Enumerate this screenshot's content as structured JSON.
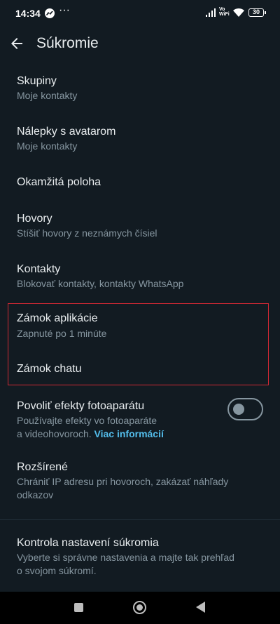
{
  "status_bar": {
    "time": "14:34",
    "vowifi_top": "Vo",
    "vowifi_bottom": "WiFi",
    "battery": "30"
  },
  "header": {
    "title": "Súkromie"
  },
  "items": [
    {
      "title": "Skupiny",
      "subtitle": "Moje kontakty"
    },
    {
      "title": "Nálepky s avatarom",
      "subtitle": "Moje kontakty"
    },
    {
      "title": "Okamžitá poloha"
    },
    {
      "title": "Hovory",
      "subtitle": "Stíšiť hovory z neznámych čísiel"
    },
    {
      "title": "Kontakty",
      "subtitle": "Blokovať kontakty, kontakty WhatsApp"
    },
    {
      "title": "Zámok aplikácie",
      "subtitle": "Zapnuté po 1 minúte"
    },
    {
      "title": "Zámok chatu"
    },
    {
      "title": "Povoliť efekty fotoaparátu",
      "subtitle_line1": "Používajte efekty vo fotoaparáte",
      "subtitle_line2": "a videohovoroch.",
      "link": "Viac informácií",
      "toggle_on": false
    },
    {
      "title": "Rozšírené",
      "subtitle_line1": "Chrániť IP adresu pri hovoroch, zakázať náhľady",
      "subtitle_line2": "odkazov"
    },
    {
      "title": "Kontrola nastavení súkromia",
      "subtitle_line1": "Vyberte si správne nastavenia a majte tak prehľad",
      "subtitle_line2": "o svojom súkromí."
    }
  ],
  "colors": {
    "background": "#121b22",
    "text_primary": "#e9edef",
    "text_secondary": "#8696a0",
    "link": "#53bdeb",
    "highlight_border": "#d02834"
  }
}
